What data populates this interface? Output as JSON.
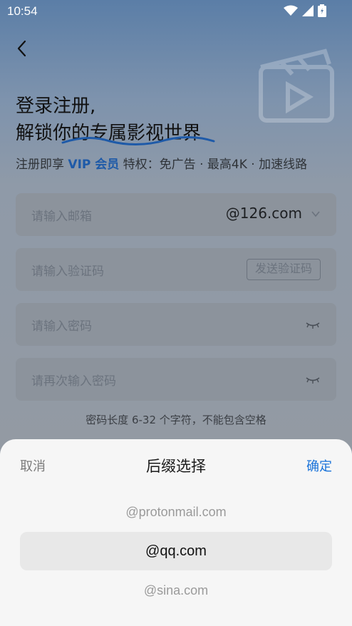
{
  "status_bar": {
    "time": "10:54"
  },
  "header": {
    "title_line1": "登录注册,",
    "title_line2": "解锁你的专属影视世界"
  },
  "subtitle": {
    "prefix": "注册即享 ",
    "vip": "VIP 会员",
    "suffix": " 特权：免广告 · 最高4K · 加速线路"
  },
  "form": {
    "email_placeholder": "请输入邮箱",
    "email_suffix": "@126.com",
    "code_placeholder": "请输入验证码",
    "send_code_label": "发送验证码",
    "password_placeholder": "请输入密码",
    "confirm_password_placeholder": "请再次输入密码",
    "password_hint": "密码长度 6-32 个字符，不能包含空格"
  },
  "sheet": {
    "cancel_label": "取消",
    "title": "后缀选择",
    "confirm_label": "确定",
    "options": [
      "@protonmail.com",
      "@qq.com",
      "@sina.com"
    ],
    "selected": "@qq.com"
  },
  "colors": {
    "accent": "#1a73d9",
    "vip": "#1e5aa8"
  },
  "icons": [
    "wifi-icon",
    "cellular-icon",
    "battery-icon",
    "back-arrow-icon",
    "clapperboard-icon",
    "chevron-down-icon",
    "eye-closed-icon"
  ]
}
